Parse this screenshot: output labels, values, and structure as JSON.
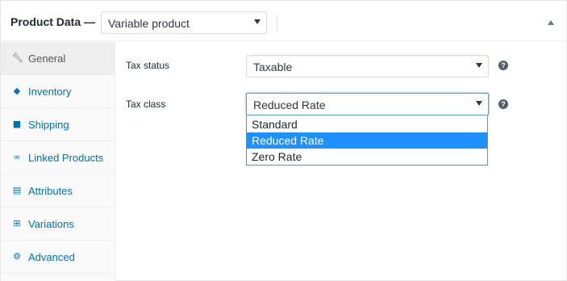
{
  "header": {
    "title": "Product Data —",
    "product_type": "Variable product"
  },
  "tabs": [
    {
      "label": "General",
      "icon": "wrench-icon",
      "active": true
    },
    {
      "label": "Inventory",
      "icon": "tag-icon"
    },
    {
      "label": "Shipping",
      "icon": "truck-icon"
    },
    {
      "label": "Linked Products",
      "icon": "link-icon"
    },
    {
      "label": "Attributes",
      "icon": "list-icon"
    },
    {
      "label": "Variations",
      "icon": "grid-icon"
    },
    {
      "label": "Advanced",
      "icon": "gear-icon"
    }
  ],
  "fields": {
    "tax_status": {
      "label": "Tax status",
      "value": "Taxable",
      "help": "?"
    },
    "tax_class": {
      "label": "Tax class",
      "value": "Reduced Rate",
      "help": "?"
    }
  },
  "tax_class_options": [
    {
      "label": "Standard"
    },
    {
      "label": "Reduced Rate",
      "selected": true
    },
    {
      "label": "Zero Rate"
    }
  ],
  "colors": {
    "accent": "#0073aa",
    "selected_option": "#1e90ff",
    "focus_border": "#5b9dd9"
  }
}
